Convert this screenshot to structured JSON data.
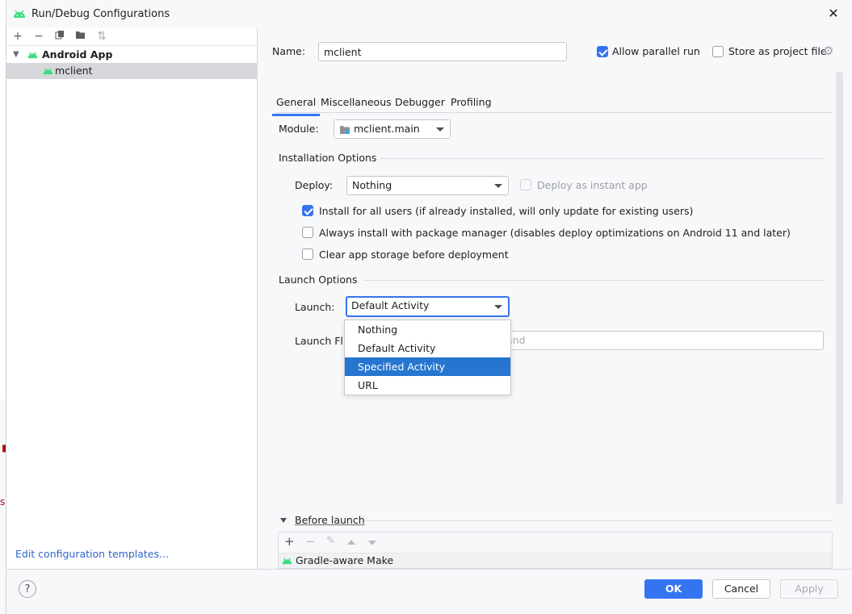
{
  "window": {
    "title": "Run/Debug Configurations"
  },
  "tree": {
    "group_label": "Android App",
    "config_label": "mclient",
    "edit_templates_link": "Edit configuration templates..."
  },
  "form": {
    "name_label": "Name:",
    "name_value": "mclient",
    "allow_parallel_label": "Allow parallel run",
    "allow_parallel_checked": true,
    "store_project_label": "Store as project file",
    "store_project_checked": false
  },
  "tabs": [
    "General",
    "Miscellaneous",
    "Debugger",
    "Profiling"
  ],
  "active_tab": "General",
  "module": {
    "label": "Module:",
    "value": "mclient.main"
  },
  "installation": {
    "section_label": "Installation Options",
    "deploy_label": "Deploy:",
    "deploy_value": "Nothing",
    "instant_app_label": "Deploy as instant app",
    "install_all_users_label": "Install for all users (if already installed, will only update for existing users)",
    "always_install_label": "Always install with package manager (disables deploy optimizations on Android 11 and later)",
    "clear_storage_label": "Clear app storage before deployment"
  },
  "launch": {
    "section_label": "Launch Options",
    "launch_label": "Launch:",
    "launch_value": "Default Activity",
    "launch_flags_label": "Launch Fl",
    "launch_flags_partial": "and",
    "dropdown_options": [
      "Nothing",
      "Default Activity",
      "Specified Activity",
      "URL"
    ],
    "highlighted_option": "Specified Activity"
  },
  "before_launch": {
    "label": "Before launch",
    "tasks": [
      "Gradle-aware Make"
    ]
  },
  "buttons": {
    "ok": "OK",
    "cancel": "Cancel",
    "apply": "Apply",
    "help": "?"
  },
  "colors": {
    "accent": "#3574f0",
    "android_green": "#3ddc84",
    "link": "#2f65ca"
  }
}
